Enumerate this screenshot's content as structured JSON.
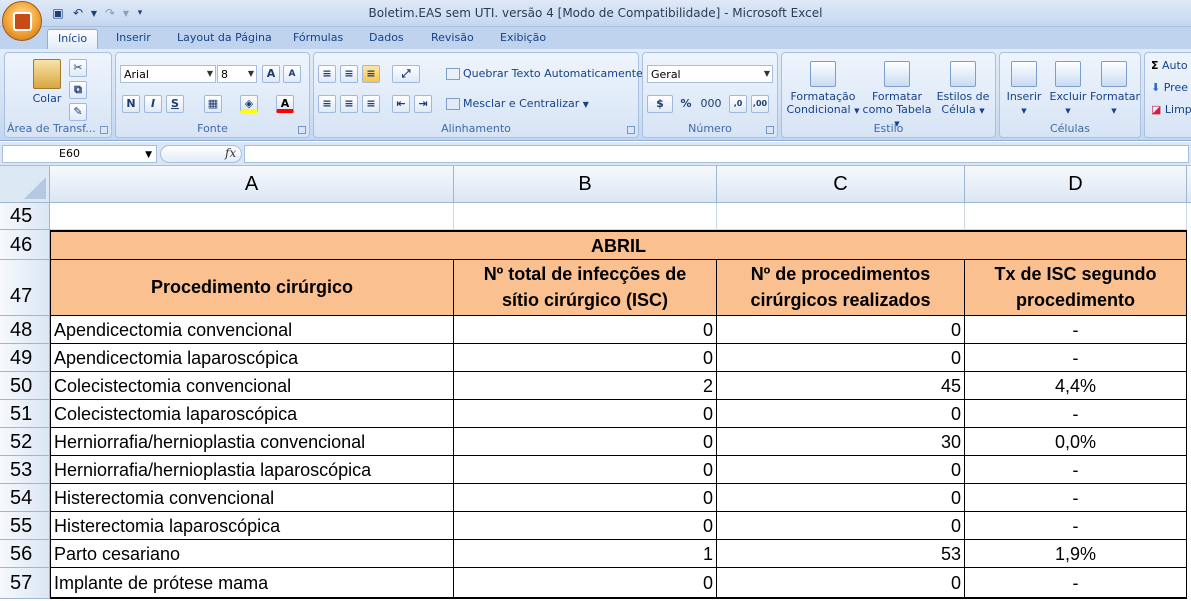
{
  "window": {
    "title": "Boletim.EAS sem UTI. versão 4  [Modo de Compatibilidade] - Microsoft Excel"
  },
  "tabs": [
    "Início",
    "Inserir",
    "Layout da Página",
    "Fórmulas",
    "Dados",
    "Revisão",
    "Exibição"
  ],
  "ribbon": {
    "clipboard": {
      "label": "Área de Transf...",
      "paste": "Colar"
    },
    "font": {
      "label": "Fonte",
      "name": "Arial",
      "size": "8",
      "bold": "N",
      "italic": "I",
      "underline": "S"
    },
    "alignment": {
      "label": "Alinhamento",
      "wrap": "Quebrar Texto Automaticamente",
      "merge": "Mesclar e Centralizar"
    },
    "number": {
      "label": "Número",
      "format": "Geral",
      "percent": "%",
      "thousands": "000"
    },
    "styles": {
      "label": "Estilo",
      "conditional": [
        "Formatação",
        "Condicional"
      ],
      "as_table": [
        "Formatar",
        "como Tabela"
      ],
      "cell_styles": [
        "Estilos de",
        "Célula"
      ]
    },
    "cells": {
      "label": "Células",
      "insert": "Inserir",
      "delete": "Excluir",
      "format": "Formatar"
    },
    "editing": {
      "autosum": "Auto",
      "fill": "Pree",
      "clear": "Limp"
    }
  },
  "formula_bar": {
    "name_box": "E60",
    "fx": "fx",
    "formula": ""
  },
  "columns": [
    "A",
    "B",
    "C",
    "D"
  ],
  "sheet": {
    "row_45": "45",
    "month_row": {
      "row": "46",
      "text": "ABRIL"
    },
    "header_row": {
      "row": "47",
      "cols": [
        [
          "Procedimento cirúrgico"
        ],
        [
          "Nº total de infecções de",
          "sítio cirúrgico (ISC)"
        ],
        [
          "Nº de procedimentos",
          "cirúrgicos realizados"
        ],
        [
          "Tx de ISC segundo",
          "procedimento"
        ]
      ]
    },
    "rows": [
      {
        "row": "48",
        "proc": "Apendicectomia convencional",
        "isc": "0",
        "n": "0",
        "tx": "-"
      },
      {
        "row": "49",
        "proc": "Apendicectomia laparoscópica",
        "isc": "0",
        "n": "0",
        "tx": "-"
      },
      {
        "row": "50",
        "proc": "Colecistectomia convencional",
        "isc": "2",
        "n": "45",
        "tx": "4,4%"
      },
      {
        "row": "51",
        "proc": "Colecistectomia laparoscópica",
        "isc": "0",
        "n": "0",
        "tx": "-"
      },
      {
        "row": "52",
        "proc": "Herniorrafia/hernioplastia convencional",
        "isc": "0",
        "n": "30",
        "tx": "0,0%"
      },
      {
        "row": "53",
        "proc": "Herniorrafia/hernioplastia laparoscópica",
        "isc": "0",
        "n": "0",
        "tx": "-"
      },
      {
        "row": "54",
        "proc": "Histerectomia convencional",
        "isc": "0",
        "n": "0",
        "tx": "-"
      },
      {
        "row": "55",
        "proc": "Histerectomia laparoscópica",
        "isc": "0",
        "n": "0",
        "tx": "-"
      },
      {
        "row": "56",
        "proc": "Parto cesariano",
        "isc": "1",
        "n": "53",
        "tx": "1,9%"
      },
      {
        "row": "57",
        "proc": "Implante de prótese mama",
        "isc": "0",
        "n": "0",
        "tx": "-"
      }
    ]
  }
}
